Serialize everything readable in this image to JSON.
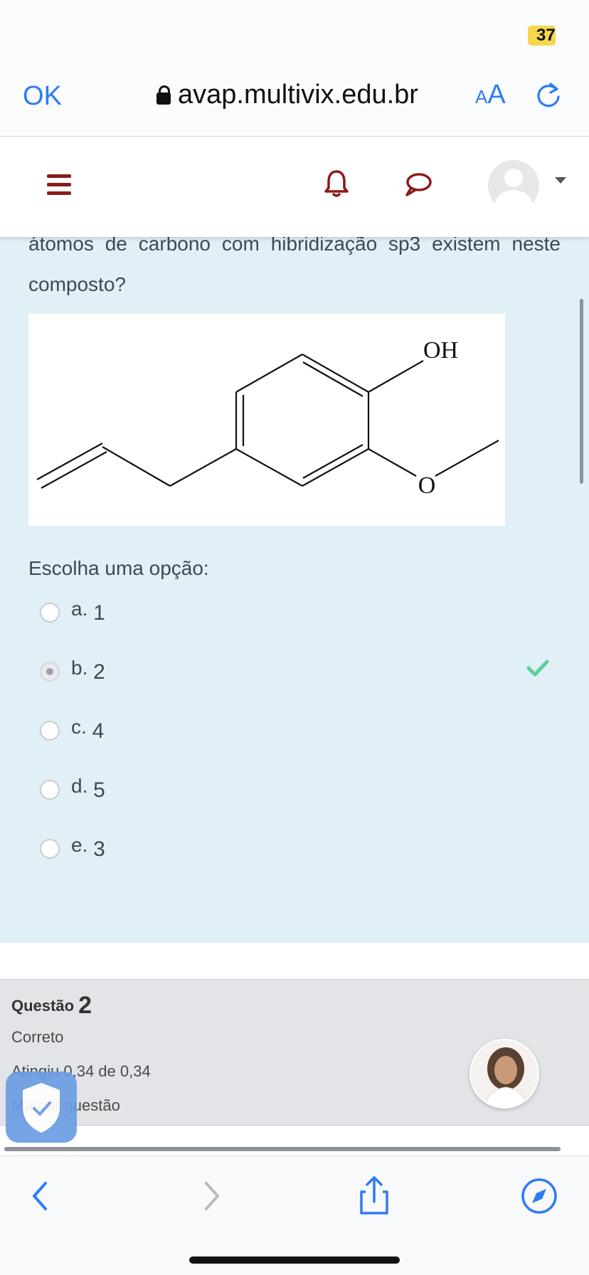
{
  "status_bar": {
    "battery": "37"
  },
  "browser": {
    "ok_label": "OK",
    "url": "avap.multivix.edu.br",
    "text_size_small": "A",
    "text_size_large": "A"
  },
  "question": {
    "text": "átomos de carbono com hibridização sp3 existem neste composto?",
    "molecule_labels": {
      "hydroxyl": "OH",
      "oxygen": "O"
    },
    "choose_label": "Escolha uma opção:",
    "options": [
      {
        "letter": "a.",
        "value": "1",
        "selected": false
      },
      {
        "letter": "b.",
        "value": "2",
        "selected": true
      },
      {
        "letter": "c.",
        "value": "4",
        "selected": false
      },
      {
        "letter": "d.",
        "value": "5",
        "selected": false
      },
      {
        "letter": "e.",
        "value": "3",
        "selected": false
      }
    ]
  },
  "question2": {
    "prefix": "Questão",
    "number": "2",
    "status": "Correto",
    "score": "Atingiu 0,34 de 0,34",
    "flag": "Marcar questão"
  },
  "colors": {
    "accent": "#2f7bf5",
    "moodle_red": "#8b1a1a",
    "question_bg": "#e1eff7",
    "correct_green": "#5dcf9a"
  }
}
